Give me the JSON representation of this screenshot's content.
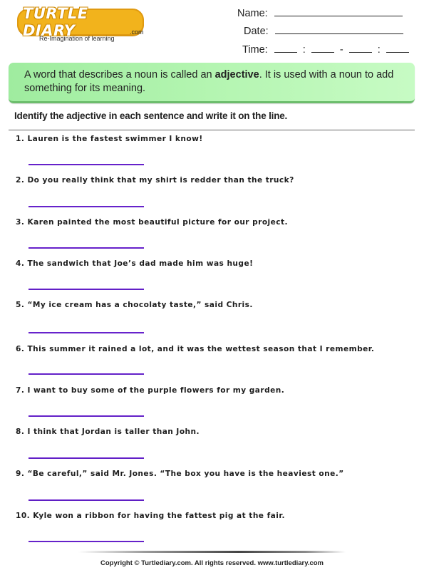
{
  "logo": {
    "wordmark": "TURTLE DIARY",
    "domain_suffix": ".com",
    "tagline": "Re-Imagination of learning",
    "colors": {
      "fill": "#f2b31c",
      "outline": "#d08a00"
    }
  },
  "header_fields": {
    "name_label": "Name:",
    "date_label": "Date:",
    "time_label": "Time:",
    "time_separators": [
      ":",
      "-",
      ":"
    ]
  },
  "definition_box": {
    "text_before": "A word that describes a noun is called an ",
    "highlight": "adjective",
    "text_after": ". It is used with a noun to add something for its meaning.",
    "colors": {
      "background": "#b4f5b1",
      "border": "#6cbd6c"
    }
  },
  "instructions": "Identify the adjective in each sentence and write it on the line.",
  "questions": [
    {
      "number": "1.",
      "text": "Lauren is the fastest swimmer I know!"
    },
    {
      "number": "2.",
      "text": "Do you really think that my shirt is redder than the truck?"
    },
    {
      "number": "3.",
      "text": "Karen painted the most beautiful picture for our project."
    },
    {
      "number": "4.",
      "text": "The sandwich that Joe’s dad made him was huge!"
    },
    {
      "number": "5.",
      "text": "“My ice cream has a chocolaty taste,” said Chris."
    },
    {
      "number": "6.",
      "text": "This summer it rained a lot, and it was the wettest season that I remember."
    },
    {
      "number": "7.",
      "text": "I want to buy some of the purple flowers for my garden."
    },
    {
      "number": "8.",
      "text": "I think that Jordan is taller than John."
    },
    {
      "number": "9.",
      "text": "“Be careful,” said Mr. Jones. “The box you have is the heaviest one.”"
    },
    {
      "number": "10.",
      "text": "Kyle won a ribbon for having the fattest pig at the fair."
    }
  ],
  "answer_line_color": "#5f1fc4",
  "footer": {
    "copyright": "Copyright © Turtlediary.com. All rights reserved. www.turtlediary.com"
  }
}
